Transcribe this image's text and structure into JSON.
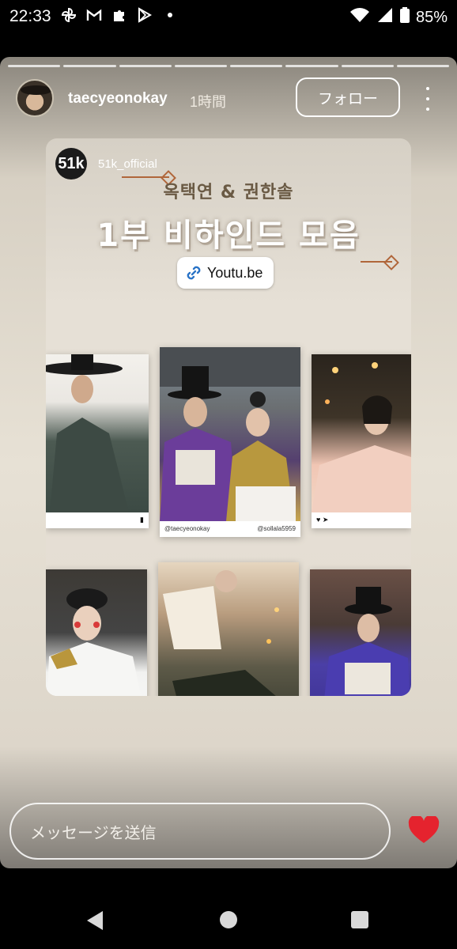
{
  "status_bar": {
    "time": "22:33",
    "battery": "85%",
    "left_icons": [
      "pinwheel-icon",
      "gmail-icon",
      "puzzle-icon",
      "play-store-icon",
      "dot-icon"
    ],
    "right_icons": [
      "wifi-icon",
      "signal-icon",
      "battery-icon"
    ]
  },
  "story": {
    "progress_segments": 8,
    "username": "taecyeonokay",
    "time_ago": "1時間",
    "follow_label": "フォロー",
    "shared_post": {
      "account_avatar_text": "51k",
      "account_name": "51k_official",
      "subtitle": "옥택연 & 권한솔",
      "title": "1부 비하인드 모음",
      "link_label": "Youtu.be",
      "cards": [
        {
          "id": "card-1",
          "handle_left": "",
          "handle_right": ""
        },
        {
          "id": "card-2",
          "handle_left": "@taecyeonokay",
          "handle_right": "@sollala5959"
        },
        {
          "id": "card-3",
          "handle_left": "",
          "handle_right": ""
        },
        {
          "id": "card-4",
          "handle_left": "",
          "handle_right": ""
        },
        {
          "id": "card-5",
          "handle_left": "",
          "handle_right": ""
        },
        {
          "id": "card-6",
          "handle_left": "",
          "handle_right": ""
        }
      ]
    },
    "message_placeholder": "メッセージを送信"
  },
  "colors": {
    "accent_heart": "#e5232e",
    "deco": "#b0663a"
  }
}
